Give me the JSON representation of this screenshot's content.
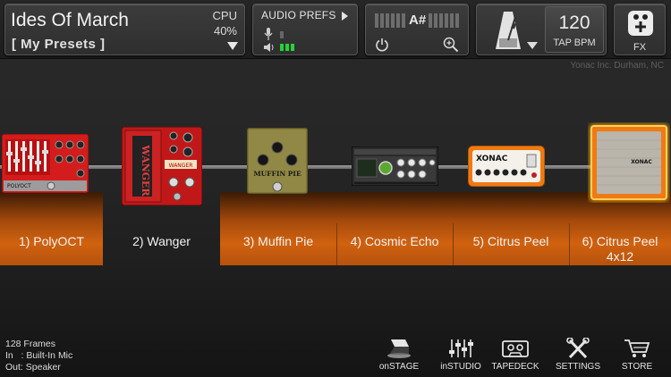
{
  "header": {
    "preset_title": "Ides Of March",
    "preset_subtitle": "[ My Presets ]",
    "cpu_label": "CPU",
    "cpu_value": "40%",
    "audio_prefs_label": "AUDIO PREFS",
    "tuner_note": "A#",
    "bpm_value": "120",
    "tap_bpm_label": "TAP BPM",
    "fx_label": "FX",
    "credit": "Yonac Inc. Durham, NC"
  },
  "chain": [
    {
      "label": "1) PolyOCT"
    },
    {
      "label": "2) Wanger"
    },
    {
      "label": "3) Muffin Pie"
    },
    {
      "label": "4) Cosmic Echo"
    },
    {
      "label": "5) Citrus Peel"
    },
    {
      "label": "6) Citrus Peel",
      "label2": "4x12"
    }
  ],
  "device_text": {
    "polyoct": "POLYOCT",
    "wanger": "WANGER",
    "muffin": "MUFFIN PIE",
    "xonac": "XONAC",
    "cab": "XONAC"
  },
  "status": {
    "frames": "128 Frames",
    "input": "In   : Built-In Mic",
    "output": "Out: Speaker"
  },
  "nav": [
    {
      "label": "onSTAGE",
      "icon": "spotlight-icon"
    },
    {
      "label": "inSTUDIO",
      "icon": "mixer-sliders-icon"
    },
    {
      "label": "TAPEDECK",
      "icon": "cassette-icon"
    },
    {
      "label": "SETTINGS",
      "icon": "tools-icon"
    },
    {
      "label": "STORE",
      "icon": "cart-icon"
    }
  ],
  "colors": {
    "accent_orange": "#d0620f",
    "meter_green": "#27d13a",
    "selected_glow": "#ffb000"
  }
}
